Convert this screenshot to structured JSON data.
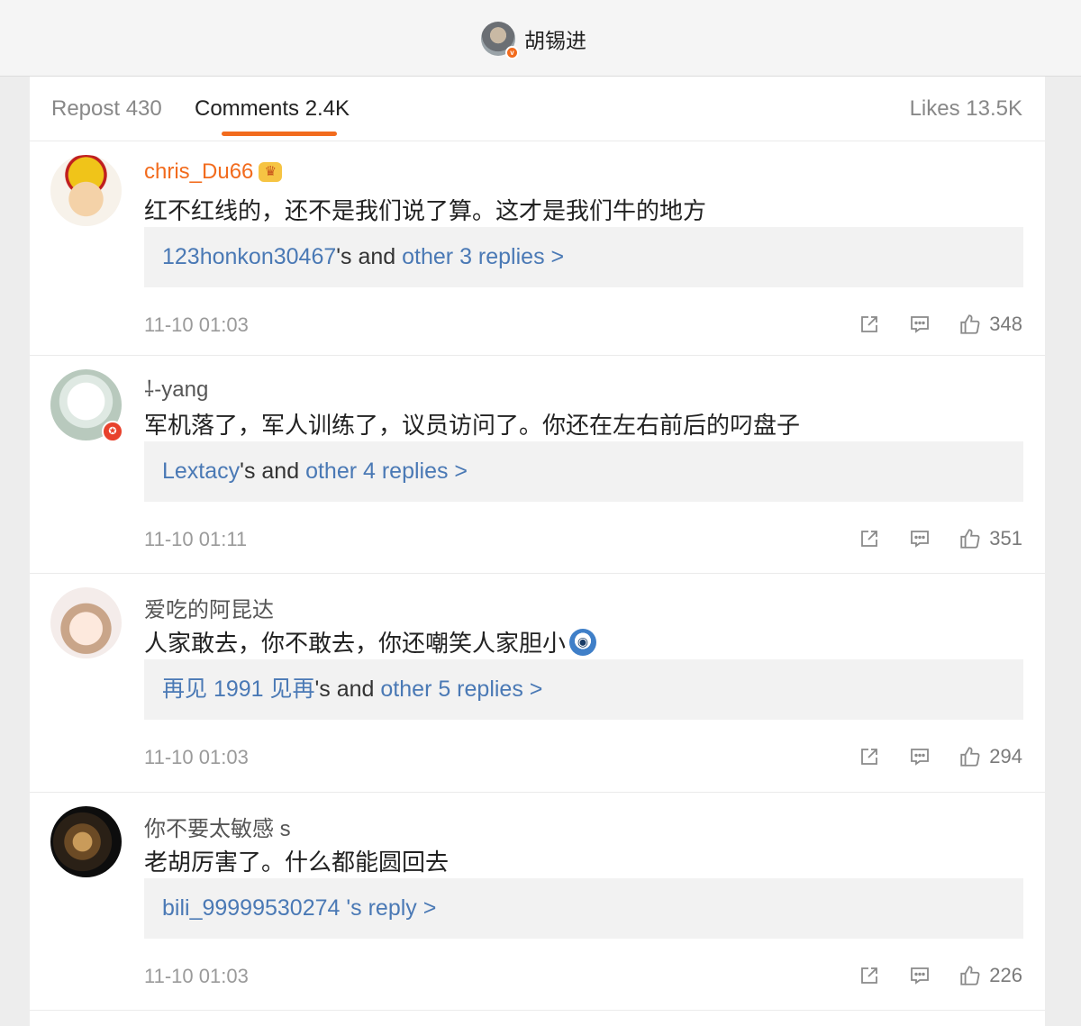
{
  "header": {
    "username": "胡锡进",
    "badge": "v"
  },
  "tabs": {
    "repost": "Repost 430",
    "comments": "Comments 2.4K",
    "likes": "Likes 13.5K"
  },
  "colors": {
    "accent": "#f26b1d",
    "link": "#4a79b5",
    "vip_name": "#f26b1d"
  },
  "comments": [
    {
      "user": "chris_Du66",
      "vip_icon": "crown-icon",
      "text": "红不红线的，还不是我们说了算。这才是我们牛的地方",
      "reply_user": "123honkon30467",
      "reply_mid": "'s and ",
      "reply_link": "other 3 replies >",
      "time": "11-10 01:03",
      "likes": "348"
    },
    {
      "user": "⸸-yang",
      "badge_icon": "star-badge-icon",
      "text": "军机落了，军人训练了，议员访问了。你还在左右前后的叼盘子",
      "reply_user": "Lextacy",
      "reply_mid": "'s and ",
      "reply_link": "other 4 replies >",
      "time": "11-10 01:11",
      "likes": "351"
    },
    {
      "user": "爱吃的阿昆达",
      "text": "人家敢去，你不敢去，你还嘲笑人家胆小",
      "emoji": "scared-face-emoji",
      "reply_user": "再见 1991 见再",
      "reply_mid": "'s and ",
      "reply_link": "other 5 replies >",
      "time": "11-10 01:03",
      "likes": "294"
    },
    {
      "user": "你不要太敏感 s",
      "text": "老胡厉害了。什么都能圆回去",
      "reply_user": "bili_99999530274",
      "reply_mid": " ",
      "reply_link": "'s reply >",
      "time": "11-10 01:03",
      "likes": "226"
    }
  ],
  "action_icons": [
    "share-icon",
    "comment-icon",
    "thumbs-up-icon"
  ]
}
